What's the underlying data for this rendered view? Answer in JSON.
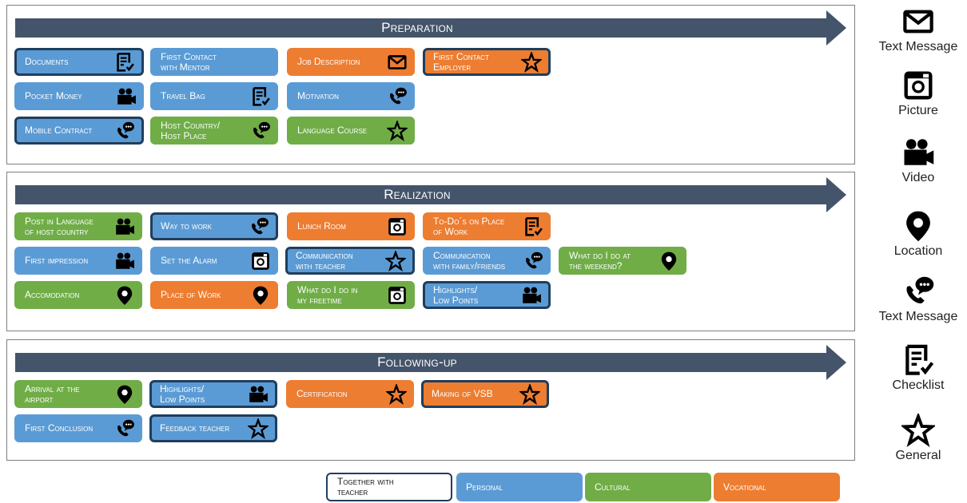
{
  "sections": [
    {
      "title": "Preparation"
    },
    {
      "title": "Realization"
    },
    {
      "title": "Following-up"
    }
  ],
  "cards": {
    "documents": "Documents",
    "first_contact_mentor": "First Contact\nwith Mentor",
    "job_description": "Job Description",
    "first_contact_employer": "First Contact\nEmployer",
    "pocket_money": "Pocket Money",
    "travel_bag": "Travel Bag",
    "motivation": "Motivation",
    "mobile_contract": "Mobile Contract",
    "host_country": "Host Country/\nHost Place",
    "language_course": "Language Course",
    "post_in_language": "Post in Language\nof host country",
    "way_to_work": "Way to work",
    "lunch_room": "Lunch Room",
    "todos_place_of_work": "To-Do´s on Place\nof Work",
    "first_impression": "First impression",
    "set_the_alarm": "Set the Alarm",
    "communication_teacher": "Communication\nwith teacher",
    "communication_family": "Communication\nwith family/friends",
    "weekend": "What do I do at\nthe weekend?",
    "accomodation": "Accomodation",
    "place_of_work": "Place of Work",
    "freetime": "What do I do in\nmy freetime",
    "highlights_real": "Highlights/\nLow Points",
    "arrival_airport": "Arrival at the\nairport",
    "highlights_follow": "Highlights/\nLow Points",
    "certification": "Certification",
    "making_of_vsb": "Making of VSB",
    "first_conclusion": "First Conclusion",
    "feedback_teacher": "Feedback teacher"
  },
  "icon_legend": [
    {
      "label": "Text Message",
      "icon": "envelope-icon"
    },
    {
      "label": "Picture",
      "icon": "camera-icon"
    },
    {
      "label": "Video",
      "icon": "video-camera-icon"
    },
    {
      "label": "Location",
      "icon": "location-pin-icon"
    },
    {
      "label": "Text Message",
      "icon": "phone-chat-icon"
    },
    {
      "label": "Checklist",
      "icon": "checklist-icon"
    },
    {
      "label": "General",
      "icon": "star-icon"
    }
  ],
  "color_key": {
    "together_with_teacher": "Together with\nteacher",
    "personal": "Personal",
    "cultural": "Cultural",
    "vocational": "Vocational"
  },
  "colors": {
    "personal": "#5b9bd5",
    "cultural": "#70ad47",
    "vocational": "#ed7d31",
    "arrow": "#44546a",
    "teacher_border": "#1f3e5e"
  }
}
